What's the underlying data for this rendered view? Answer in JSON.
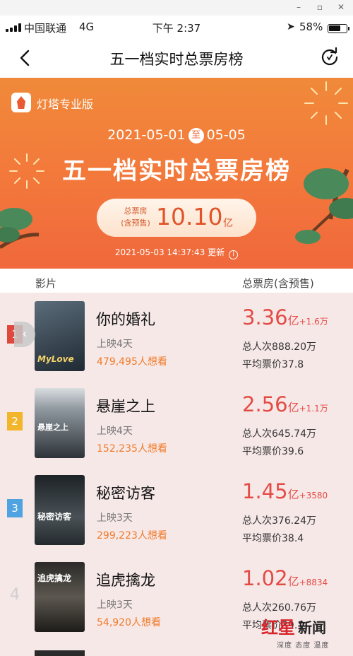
{
  "status_bar": {
    "carrier": "中国联通",
    "network": "4G",
    "time": "下午 2:37",
    "battery": "58%"
  },
  "nav": {
    "title": "五一档实时总票房榜"
  },
  "banner": {
    "brand": "灯塔专业版",
    "date_start": "2021-05-01",
    "date_sep": "至",
    "date_end": "05-05",
    "title": "五一档实时总票房榜",
    "total_label_1": "总票房",
    "total_label_2": "(含预售)",
    "total_value": "10.10",
    "total_unit": "亿",
    "updated": "2021-05-03 14:37:43 更新",
    "info_glyph": "i"
  },
  "table_header": {
    "film": "影片",
    "gross": "总票房(含预售)"
  },
  "collapse_glyph": "‹",
  "movies": [
    {
      "rank": "1",
      "name": "你的婚礼",
      "days": "上映4天",
      "want": "479,495人想看",
      "gross": "3.36",
      "unit": "亿",
      "delta": "+1.6万",
      "people": "总人次888.20万",
      "price": "平均票价37.8",
      "poster_text": "MyLove",
      "poster_color": "#3a4a5a"
    },
    {
      "rank": "2",
      "name": "悬崖之上",
      "days": "上映4天",
      "want": "152,235人想看",
      "gross": "2.56",
      "unit": "亿",
      "delta": "+1.1万",
      "people": "总人次645.74万",
      "price": "平均票价39.6",
      "poster_text": "悬崖之上",
      "poster_color": "#5a6068"
    },
    {
      "rank": "3",
      "name": "秘密访客",
      "days": "上映3天",
      "want": "299,223人想看",
      "gross": "1.45",
      "unit": "亿",
      "delta": "+3580",
      "people": "总人次376.24万",
      "price": "平均票价38.4",
      "poster_text": "秘密访客",
      "poster_color": "#2e3438"
    },
    {
      "rank": "4",
      "name": "追虎擒龙",
      "days": "上映3天",
      "want": "54,920人想看",
      "gross": "1.02",
      "unit": "亿",
      "delta": "+8834",
      "people": "总人次260.76万",
      "price": "平均票价39.1",
      "poster_text": "追虎擒龙",
      "poster_color": "#3c3a36"
    }
  ],
  "watermark": {
    "brand_red": "红星",
    "brand_black": "新闻",
    "tagline": "深度 态度 温度"
  }
}
